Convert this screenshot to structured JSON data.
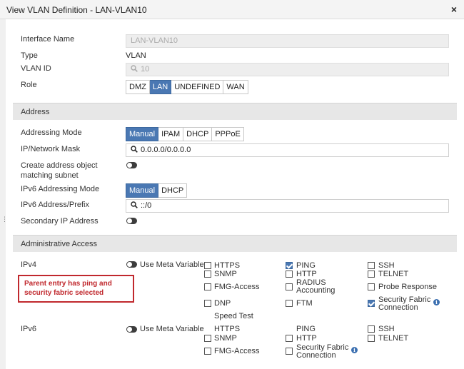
{
  "window": {
    "title": "View VLAN Definition - LAN-VLAN10",
    "close_glyph": "×"
  },
  "form": {
    "interface_name": {
      "label": "Interface Name",
      "value": "LAN-VLAN10"
    },
    "type": {
      "label": "Type",
      "value": "VLAN"
    },
    "vlan_id": {
      "label": "VLAN ID",
      "value": "10"
    },
    "role": {
      "label": "Role",
      "options": [
        "DMZ",
        "LAN",
        "UNDEFINED",
        "WAN"
      ],
      "selected": "LAN"
    }
  },
  "address": {
    "section_title": "Address",
    "addressing_mode": {
      "label": "Addressing Mode",
      "options": [
        "Manual",
        "IPAM",
        "DHCP",
        "PPPoE"
      ],
      "selected": "Manual"
    },
    "ip_mask": {
      "label": "IP/Network Mask",
      "value": "0.0.0.0/0.0.0.0"
    },
    "create_object": {
      "label_line1": "Create address object",
      "label_line2": "matching subnet",
      "enabled": false
    },
    "ipv6_mode": {
      "label": "IPv6 Addressing Mode",
      "options": [
        "Manual",
        "DHCP"
      ],
      "selected": "Manual"
    },
    "ipv6_prefix": {
      "label": "IPv6 Address/Prefix",
      "value": "::/0"
    },
    "secondary_ip": {
      "label": "Secondary IP Address",
      "enabled": false
    }
  },
  "admin_access": {
    "section_title": "Administrative Access",
    "ipv4": {
      "label": "IPv4",
      "meta_variable_label": "Use Meta Variable",
      "items": [
        {
          "label": "HTTPS",
          "checked": false
        },
        {
          "label": "PING",
          "checked": true
        },
        {
          "label": "SSH",
          "checked": false
        },
        {
          "label": "SNMP",
          "checked": false
        },
        {
          "label": "HTTP",
          "checked": false
        },
        {
          "label": "TELNET",
          "checked": false
        },
        {
          "label": "FMG-Access",
          "checked": false
        },
        {
          "label": "RADIUS",
          "label2": "Accounting",
          "checked": false
        },
        {
          "label": "Probe Response",
          "checked": false
        },
        {
          "label": "DNP",
          "checked": false
        },
        {
          "label": "FTM",
          "checked": false
        },
        {
          "label": "Security Fabric",
          "label2": "Connection",
          "checked": true
        },
        {
          "label": "Speed Test",
          "checked": false
        }
      ]
    },
    "ipv6": {
      "label": "IPv6",
      "meta_variable_label": "Use Meta Variable",
      "items": [
        {
          "label": "HTTPS",
          "checked": false
        },
        {
          "label": "PING",
          "checked": false
        },
        {
          "label": "SSH",
          "checked": false
        },
        {
          "label": "SNMP",
          "checked": false
        },
        {
          "label": "HTTP",
          "checked": false
        },
        {
          "label": "TELNET",
          "checked": false
        },
        {
          "label": "FMG-Access",
          "checked": false
        },
        {
          "label": "Security Fabric",
          "label2": "Connection",
          "checked": false
        }
      ]
    }
  },
  "annotation": {
    "text": "Parent entry has ping and security fabric selected"
  },
  "colors": {
    "accent": "#4a78b3",
    "annotation": "#c0282d",
    "section_bg": "#e7e7e7"
  }
}
